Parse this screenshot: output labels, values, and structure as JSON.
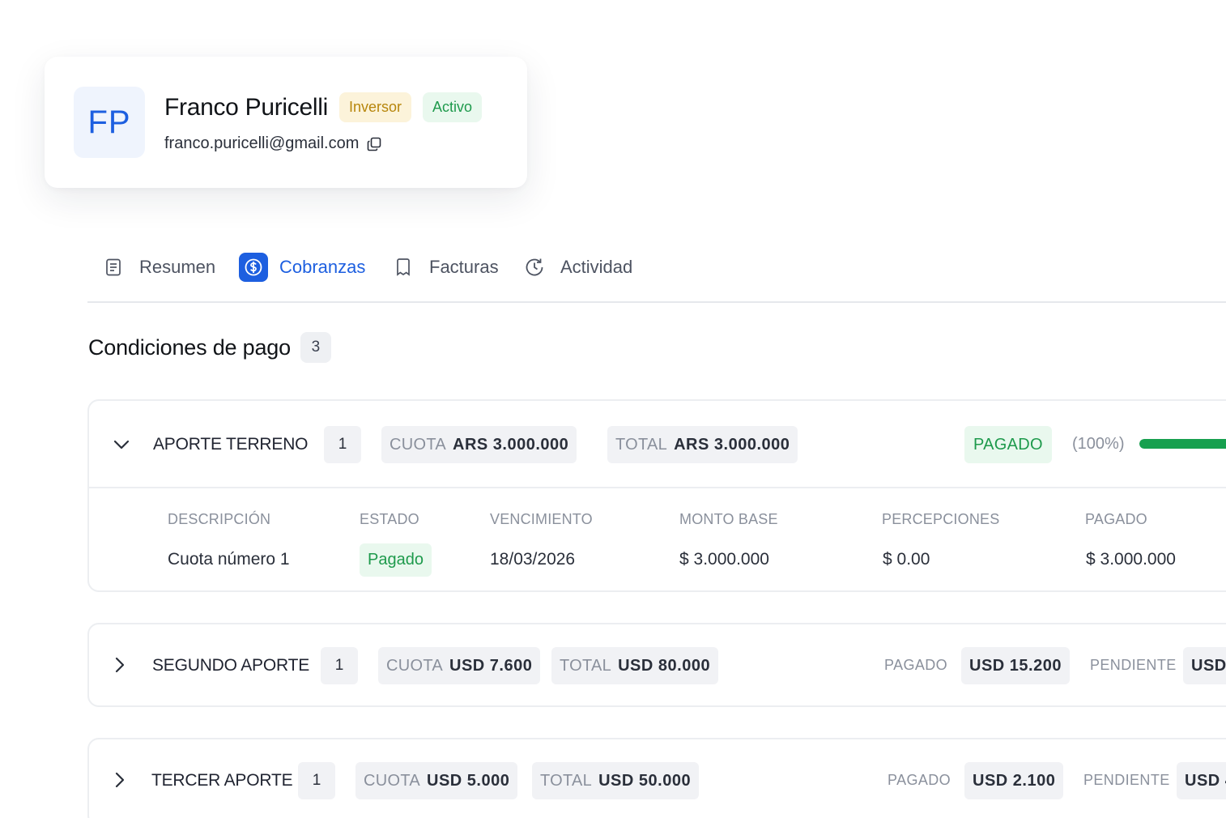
{
  "profile": {
    "initials": "FP",
    "name": "Franco Puricelli",
    "role_badge": "Inversor",
    "status_badge": "Activo",
    "email": "franco.puricelli@gmail.com"
  },
  "tabs": [
    {
      "label": "Resumen",
      "icon": "document-icon",
      "active": false
    },
    {
      "label": "Cobranzas",
      "icon": "dollar-circle-icon",
      "active": true
    },
    {
      "label": "Facturas",
      "icon": "receipt-icon",
      "active": false
    },
    {
      "label": "Actividad",
      "icon": "history-clock-icon",
      "active": false
    }
  ],
  "section": {
    "title": "Condiciones de pago",
    "count": "3"
  },
  "conditions": [
    {
      "name": "APORTE TERRENO",
      "installments": "1",
      "cuota_label": "CUOTA",
      "cuota_value": "ARS 3.000.000",
      "total_label": "TOTAL",
      "total_value": "ARS 3.000.000",
      "status": "PAGADO",
      "percent_text": "(100%)",
      "progress": 1.0,
      "expanded": true,
      "columns": [
        "DESCRIPCIÓN",
        "ESTADO",
        "VENCIMIENTO",
        "MONTO BASE",
        "PERCEPCIONES",
        "PAGADO"
      ],
      "rows": [
        {
          "descripcion": "Cuota número 1",
          "estado": "Pagado",
          "vencimiento": "18/03/2026",
          "monto_base": "$ 3.000.000",
          "percepciones": "$ 0.00",
          "pagado": "$ 3.000.000"
        }
      ]
    },
    {
      "name": "SEGUNDO APORTE",
      "installments": "1",
      "cuota_label": "CUOTA",
      "cuota_value": "USD 7.600",
      "total_label": "TOTAL",
      "total_value": "USD 80.000",
      "pagado_label": "PAGADO",
      "pagado_value": "USD 15.200",
      "pendiente_label": "PENDIENTE",
      "pendiente_value": "USD",
      "expanded": false
    },
    {
      "name": "TERCER APORTE",
      "installments": "1",
      "cuota_label": "CUOTA",
      "cuota_value": "USD 5.000",
      "total_label": "TOTAL",
      "total_value": "USD 50.000",
      "pagado_label": "PAGADO",
      "pagado_value": "USD 2.100",
      "pendiente_label": "PENDIENTE",
      "pendiente_value": "USD 4",
      "expanded": false
    }
  ],
  "colors": {
    "accent": "#1d5fe0",
    "success": "#1e9a4c",
    "warning": "#b7860c"
  }
}
